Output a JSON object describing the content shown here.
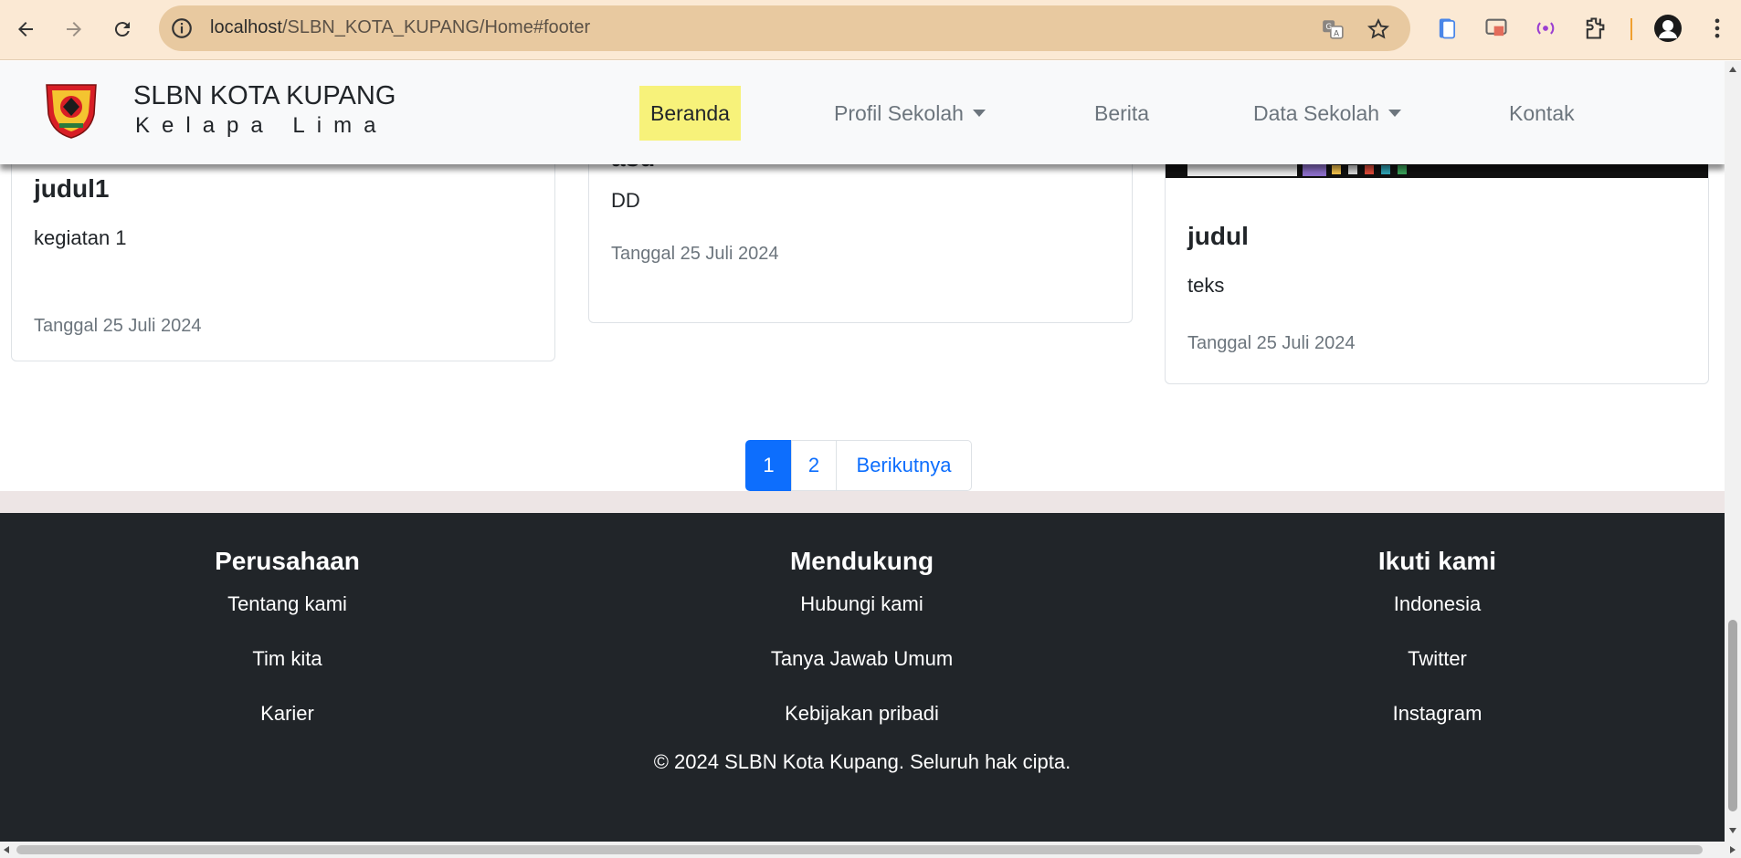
{
  "browser": {
    "url_host": "localhost",
    "url_path": "/SLBN_KOTA_KUPANG/Home#footer",
    "icons": [
      "back-icon",
      "forward-icon",
      "reload-icon",
      "info-icon",
      "translate-icon",
      "bookmark-star-icon",
      "extension-icons",
      "profile-avatar-icon",
      "menu-icon"
    ]
  },
  "navbar": {
    "brand_title": "SLBN KOTA KUPANG",
    "brand_subtitle": "Kelapa Lima",
    "items": [
      {
        "label": "Beranda",
        "active": true
      },
      {
        "label": "Profil Sekolah",
        "dropdown": true
      },
      {
        "label": "Berita"
      },
      {
        "label": "Data Sekolah",
        "dropdown": true
      },
      {
        "label": "Kontak"
      }
    ]
  },
  "cards": [
    {
      "title": "judul1",
      "text": "kegiatan 1",
      "date": "Tanggal 25 Juli 2024"
    },
    {
      "title": "asd",
      "text": "DD",
      "date": "Tanggal 25 Juli 2024"
    },
    {
      "title": "judul",
      "text": "teks",
      "date": "Tanggal 25 Juli 2024"
    }
  ],
  "pagination": {
    "pages": [
      "1",
      "2"
    ],
    "current": "1",
    "next_label": "Berikutnya"
  },
  "footer": {
    "columns": [
      {
        "heading": "Perusahaan",
        "links": [
          "Tentang kami",
          "Tim kita",
          "Karier"
        ]
      },
      {
        "heading": "Mendukung",
        "links": [
          "Hubungi kami",
          "Tanya Jawab Umum",
          "Kebijakan pribadi"
        ]
      },
      {
        "heading": "Ikuti kami",
        "links": [
          "Indonesia",
          "Twitter",
          "Instagram"
        ]
      }
    ],
    "copyright": "© 2024 SLBN Kota Kupang. Seluruh hak cipta."
  },
  "colors": {
    "primary": "#0d6efd",
    "active_nav_bg": "#f7f27a",
    "footer_bg": "#212529",
    "chrome_bg": "#fbe9d4"
  }
}
